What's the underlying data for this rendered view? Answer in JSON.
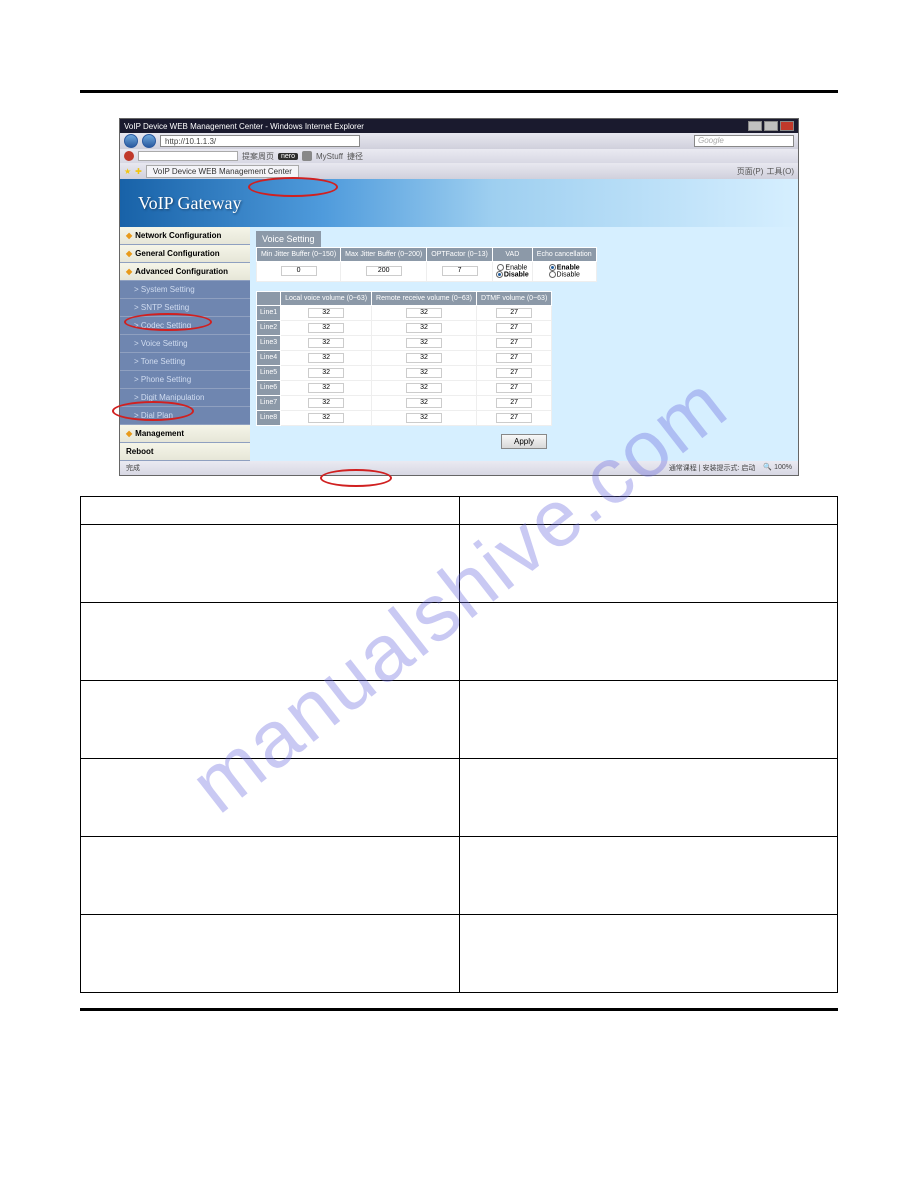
{
  "watermark": "manualshive.com",
  "browser": {
    "title": "VoIP Device WEB Management Center - Windows Internet Explorer",
    "url": "http://10.1.1.3/",
    "search_placeholder": "Google",
    "toolbar": {
      "item1": "提案周页",
      "nero": "nero",
      "mystuff": "MyStuff",
      "other": "捷径"
    },
    "tab": "VoIP Device WEB Management Center",
    "tabbar_right": {
      "a": "页面(P)",
      "b": "工具(O)"
    },
    "status_left": "完成",
    "status_mid": "通常课程 | 安装提示式: 启动",
    "status_zoom": "100%"
  },
  "banner": "VoIP  Gateway",
  "sidebar": {
    "s1": "Network Configuration",
    "s2": "General Configuration",
    "s3": "Advanced Configuration",
    "sub1": "> System Setting",
    "sub2": "> SNTP Setting",
    "sub3": "> Codec Setting",
    "sub4": "> Voice Setting",
    "sub5": "> Tone Setting",
    "sub6": "> Phone Setting",
    "sub7": "> Digit Manipulation",
    "sub8": "> Dial Plan",
    "s4": "Management",
    "s5": "Reboot"
  },
  "voice": {
    "title": "Voice Setting",
    "h1": "Min Jitter Buffer (0~150)",
    "h2": "Max Jitter Buffer (0~200)",
    "h3": "OPTFactor (0~13)",
    "h4": "VAD",
    "h5": "Echo cancellation",
    "v1": "0",
    "v2": "200",
    "v3": "7",
    "enable": "Enable",
    "disable": "Disable"
  },
  "lines": {
    "h1": "Local voice volume (0~63)",
    "h2": "Remote receive volume (0~63)",
    "h3": "DTMF volume (0~63)",
    "rows": [
      {
        "n": "Line1",
        "a": "32",
        "b": "32",
        "c": "27"
      },
      {
        "n": "Line2",
        "a": "32",
        "b": "32",
        "c": "27"
      },
      {
        "n": "Line3",
        "a": "32",
        "b": "32",
        "c": "27"
      },
      {
        "n": "Line4",
        "a": "32",
        "b": "32",
        "c": "27"
      },
      {
        "n": "Line5",
        "a": "32",
        "b": "32",
        "c": "27"
      },
      {
        "n": "Line6",
        "a": "32",
        "b": "32",
        "c": "27"
      },
      {
        "n": "Line7",
        "a": "32",
        "b": "32",
        "c": "27"
      },
      {
        "n": "Line8",
        "a": "32",
        "b": "32",
        "c": "27"
      }
    ]
  },
  "apply": "Apply"
}
